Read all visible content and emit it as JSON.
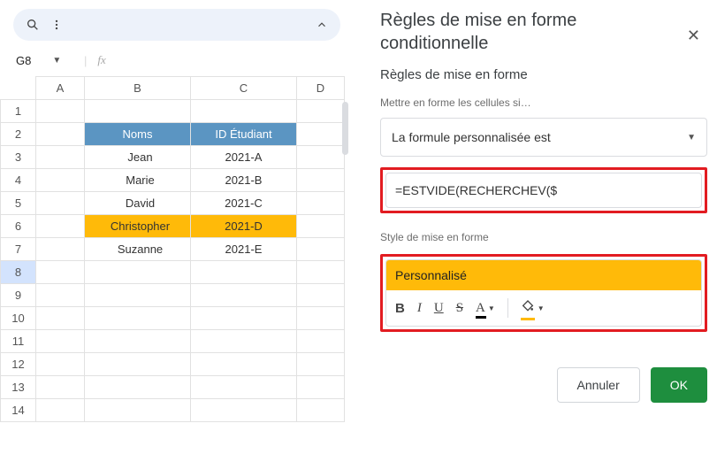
{
  "toolbar": {
    "search_icon": "search",
    "more_icon": "more",
    "expand_icon": "chevron-up"
  },
  "name_box": {
    "cell_ref": "G8",
    "fx_label": "fx"
  },
  "columns": [
    "A",
    "B",
    "C",
    "D"
  ],
  "row_numbers": [
    "1",
    "2",
    "3",
    "4",
    "5",
    "6",
    "7",
    "8",
    "9",
    "10",
    "11",
    "12",
    "13",
    "14"
  ],
  "headers": {
    "names": "Noms",
    "id": "ID Étudiant"
  },
  "rows": [
    {
      "name": "Jean",
      "id": "2021-A",
      "highlight": false
    },
    {
      "name": "Marie",
      "id": "2021-B",
      "highlight": false
    },
    {
      "name": "David",
      "id": "2021-C",
      "highlight": false
    },
    {
      "name": "Christopher",
      "id": "2021-D",
      "highlight": true
    },
    {
      "name": "Suzanne",
      "id": "2021-E",
      "highlight": false
    }
  ],
  "panel": {
    "title": "Règles de mise en forme conditionnelle",
    "subtitle": "Règles de mise en forme",
    "format_if_label": "Mettre en forme les cellules si…",
    "condition_option": "La formule personnalisée est",
    "formula": "=ESTVIDE(RECHERCHEV($",
    "style_label": "Style de mise en forme",
    "style_name": "Personnalisé",
    "cancel": "Annuler",
    "ok": "OK",
    "colors": {
      "highlight": "#ffba09",
      "ok_btn": "#1e8e3e",
      "red_box": "#e21c21"
    },
    "format_tools": {
      "bold": "B",
      "italic": "I",
      "underline": "U",
      "strike": "S",
      "text_color": "A",
      "fill": "bucket"
    }
  }
}
